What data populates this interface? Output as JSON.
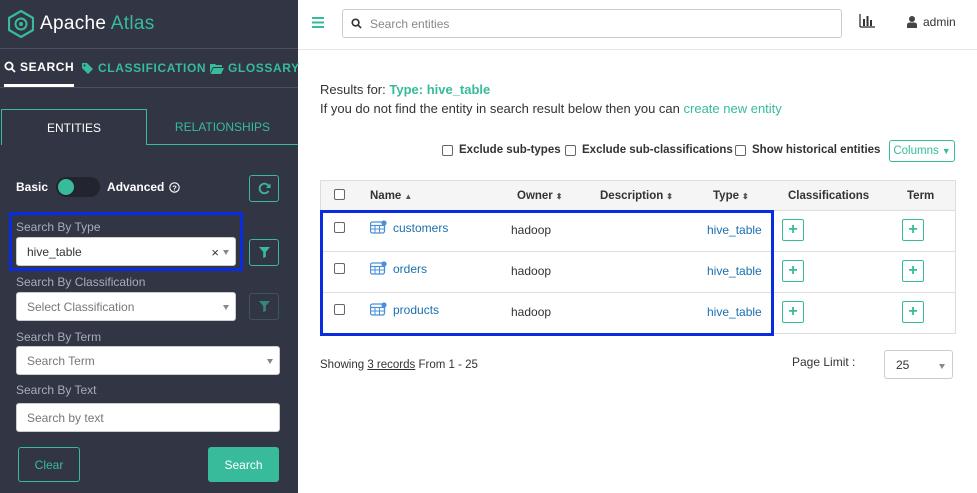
{
  "app": {
    "name_part1": "Apache",
    "name_part2": "Atlas",
    "brand_color": "#37bb9b",
    "sidebar_bg": "#323544"
  },
  "main_tabs": [
    {
      "label": "SEARCH",
      "icon": "search-icon",
      "active": true
    },
    {
      "label": "CLASSIFICATION",
      "icon": "tag-icon",
      "active": false
    },
    {
      "label": "GLOSSARY",
      "icon": "folder-open-icon",
      "active": false
    }
  ],
  "sub_tabs": [
    {
      "label": "ENTITIES",
      "active": true
    },
    {
      "label": "RELATIONSHIPS",
      "active": false
    }
  ],
  "search_mode": {
    "basic": "Basic",
    "advanced": "Advanced",
    "selected": "Basic"
  },
  "filters": {
    "type_label": "Search By Type",
    "type_value": "hive_table",
    "classification_label": "Search By Classification",
    "classification_placeholder": "Select Classification",
    "term_label": "Search By Term",
    "term_placeholder": "Search Term",
    "text_label": "Search By Text",
    "text_placeholder": "Search by text"
  },
  "buttons": {
    "clear": "Clear",
    "search": "Search",
    "columns": "Columns"
  },
  "topbar": {
    "search_placeholder": "Search entities",
    "user": "admin"
  },
  "results": {
    "prefix": "Results for:",
    "type_text": "Type: hive_table",
    "notice": "If you do not find the entity in search result below then you can",
    "create_link": "create new entity"
  },
  "options": {
    "exclude_subtypes": "Exclude sub-types",
    "exclude_subclassifications": "Exclude sub-classifications",
    "show_historical": "Show historical entities"
  },
  "table": {
    "headers": {
      "name": "Name",
      "owner": "Owner",
      "description": "Description",
      "type": "Type",
      "classifications": "Classifications",
      "term": "Term"
    },
    "rows": [
      {
        "name": "customers",
        "owner": "hadoop",
        "description": "",
        "type": "hive_table"
      },
      {
        "name": "orders",
        "owner": "hadoop",
        "description": "",
        "type": "hive_table"
      },
      {
        "name": "products",
        "owner": "hadoop",
        "description": "",
        "type": "hive_table"
      }
    ]
  },
  "footer": {
    "showing": "Showing",
    "records": "3 records",
    "range": "From 1 - 25",
    "page_limit_label": "Page Limit :",
    "page_limit_value": "25"
  }
}
